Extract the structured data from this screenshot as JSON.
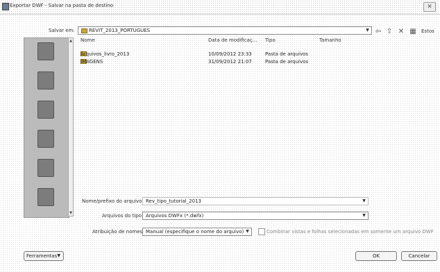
{
  "window": {
    "title": "Exportar DWF - Salvar na pasta de destino"
  },
  "save_in": {
    "label": "Salvar em:",
    "value": "REVIT_2013_PORTUGUES"
  },
  "toolbar": {
    "icons": [
      "back-icon",
      "up-folder-icon",
      "delete-icon",
      "views-icon"
    ],
    "tools_label": "Estos"
  },
  "places": [
    "recent-places-icon",
    "desktop-icon",
    "documents-icon",
    "computer-icon",
    "network-icon",
    "favorites-icon"
  ],
  "file_list": {
    "columns": [
      "Nome",
      "Data de modificaç...",
      "Tipo",
      "Tamanho"
    ],
    "rows": [
      {
        "name": "Arquivos_livro_2013",
        "date": "10/09/2012 23:33",
        "type": "Pasta de arquivos",
        "size": ""
      },
      {
        "name": "IMAGENS",
        "date": "31/09/2012 21:07",
        "type": "Pasta de arquivos",
        "size": ""
      }
    ]
  },
  "filename": {
    "label": "Nome/prefixo do arquivo:",
    "value": "Rev_tipo_tutorial_2013"
  },
  "filetype": {
    "label": "Arquivos do tipo:",
    "value": "Arquivos DWFx (*.dwfx)"
  },
  "naming": {
    "label": "Atribuição de nomes:",
    "value": "Manual (especifique o nome do arquivo)",
    "combine_label": "Combinar vistas e folhas selecionadas em somente um arquivo DWF"
  },
  "buttons": {
    "tools": "Ferramentas",
    "ok": "OK",
    "cancel": "Cancelar"
  }
}
